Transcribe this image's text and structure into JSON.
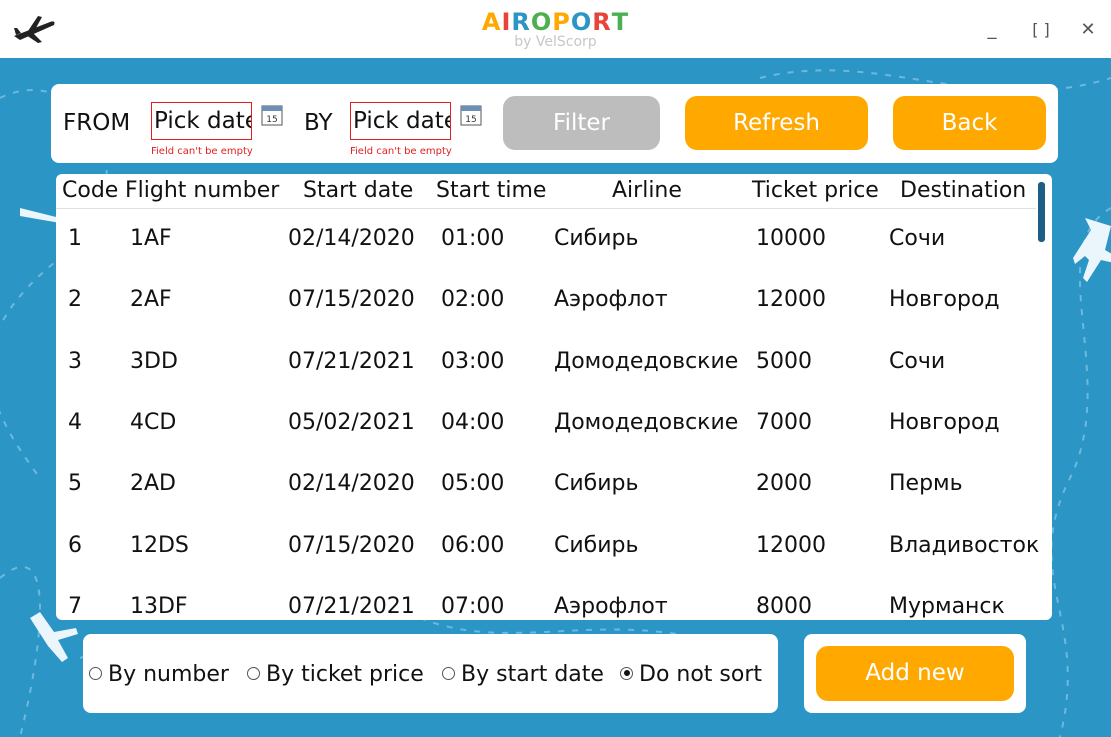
{
  "titlebar": {
    "brand_letters": [
      {
        "ch": "A",
        "color": "#ffa800"
      },
      {
        "ch": "I",
        "color": "#e6443a"
      },
      {
        "ch": "R",
        "color": "#2b95c5"
      },
      {
        "ch": "O",
        "color": "#4caf50"
      },
      {
        "ch": "P",
        "color": "#ffa800"
      },
      {
        "ch": "O",
        "color": "#2b95c5"
      },
      {
        "ch": "R",
        "color": "#e6443a"
      },
      {
        "ch": "T",
        "color": "#4caf50"
      }
    ],
    "subtitle": "by VelScorp",
    "minimize": "_",
    "maximize": "[ ]",
    "close": "✕"
  },
  "filter": {
    "from_label": "FROM",
    "by_label": "BY",
    "from_value": "Pick date",
    "by_value": "Pick date",
    "from_error": "Field can't be empty",
    "by_error": "Field can't be empty",
    "calendar_day": "15",
    "filter_button": "Filter",
    "refresh_button": "Refresh",
    "back_button": "Back"
  },
  "table": {
    "headers": [
      "Code",
      "Flight number",
      "Start date",
      "Start time",
      "Airline",
      "Ticket price",
      "Destination"
    ],
    "rows": [
      [
        "1",
        "1AF",
        "02/14/2020",
        "01:00",
        "Сибирь",
        "10000",
        "Сочи"
      ],
      [
        "2",
        "2AF",
        "07/15/2020",
        "02:00",
        "Аэрофлот",
        "12000",
        "Новгород"
      ],
      [
        "3",
        "3DD",
        "07/21/2021",
        "03:00",
        "Домодедовские",
        "5000",
        "Сочи"
      ],
      [
        "4",
        "4CD",
        "05/02/2021",
        "04:00",
        "Домодедовские",
        "7000",
        "Новгород"
      ],
      [
        "5",
        "2AD",
        "02/14/2020",
        "05:00",
        "Сибирь",
        "2000",
        "Пермь"
      ],
      [
        "6",
        "12DS",
        "07/15/2020",
        "06:00",
        "Сибирь",
        "12000",
        "Владивосток"
      ],
      [
        "7",
        "13DF",
        "07/21/2021",
        "07:00",
        "Аэрофлот",
        "8000",
        "Мурманск"
      ]
    ]
  },
  "sort": {
    "options": [
      "By number",
      "By ticket price",
      "By start date",
      "Do not sort"
    ],
    "selected": "Do not sort"
  },
  "add_button": "Add new",
  "colors": {
    "accent": "#ffa800",
    "background": "#2b95c5",
    "error": "#e02020",
    "disabled": "#bdbdbd"
  }
}
